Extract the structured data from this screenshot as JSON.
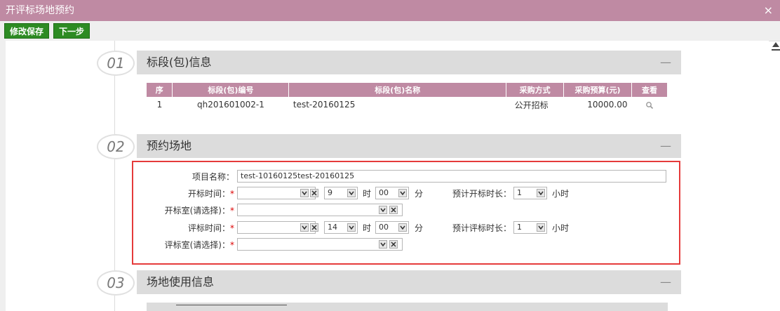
{
  "window": {
    "title": "开评标场地预约",
    "close_glyph": "×"
  },
  "toolbar": {
    "save_label": "修改保存",
    "next_label": "下一步"
  },
  "sections": [
    {
      "number": "01",
      "title": "标段(包)信息",
      "collapse_glyph": "—"
    },
    {
      "number": "02",
      "title": "预约场地",
      "collapse_glyph": "—"
    },
    {
      "number": "03",
      "title": "场地使用信息",
      "collapse_glyph": "—"
    }
  ],
  "lots_table": {
    "headers": [
      "序",
      "标段(包)编号",
      "标段(包)名称",
      "采购方式",
      "采购预算(元)",
      "查看"
    ],
    "rows": [
      {
        "index": "1",
        "code": "qh201601002-1",
        "name": "test-20160125",
        "method": "公开招标",
        "budget": "10000.00",
        "view_icon": "search-icon"
      }
    ]
  },
  "booking": {
    "project_name_label": "项目名称：",
    "project_name_value": "test-10160125test-20160125",
    "open_time_label": "开标时间：",
    "open_hour": "9",
    "open_minute": "00",
    "eval_time_label": "评标时间：",
    "eval_hour": "14",
    "eval_minute": "00",
    "hour_unit": "时",
    "minute_unit": "分",
    "open_room_label": "开标室(请选择)：",
    "eval_room_label": "评标室(请选择)：",
    "open_duration_label": "预计开标时长：",
    "open_duration": "1",
    "eval_duration_label": "预计评标时长：",
    "eval_duration": "1",
    "duration_unit": "小时",
    "required_mark": "*"
  },
  "colors": {
    "accent": "#bf8aa3",
    "button": "#2d8b23",
    "highlight_border": "#e53b3b"
  }
}
